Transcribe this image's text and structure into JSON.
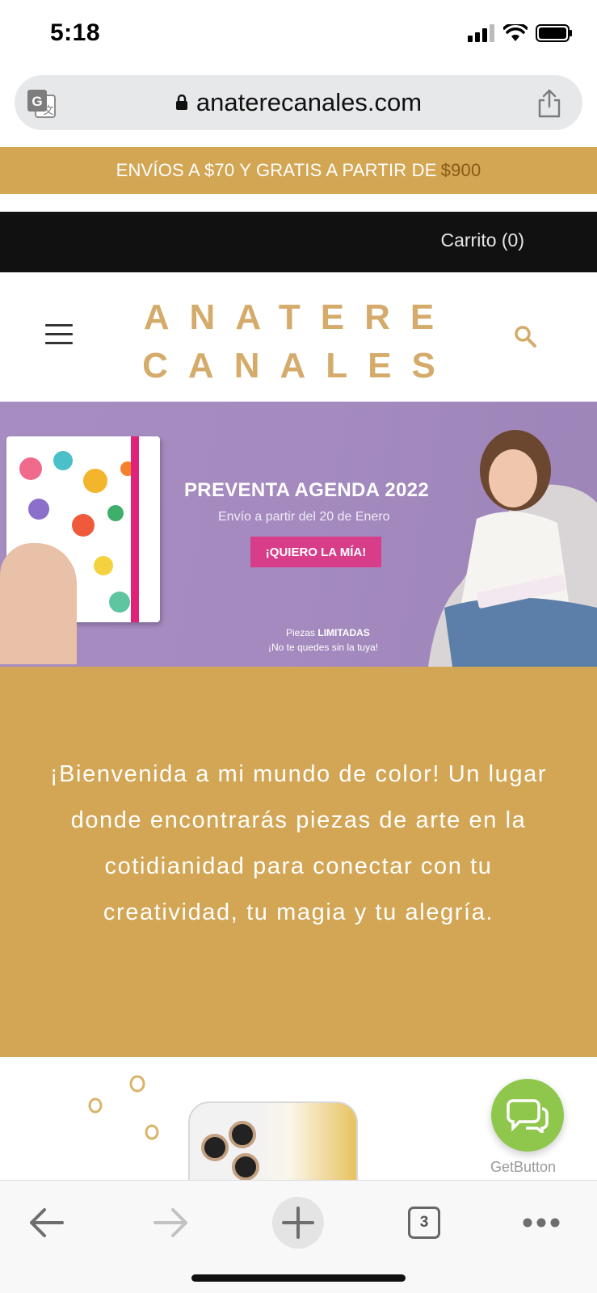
{
  "status_bar": {
    "time": "5:18"
  },
  "browser": {
    "url": "anaterecanales.com",
    "tab_count": "3"
  },
  "promo": {
    "text": "ENVÍOS A $70 Y GRATIS A PARTIR DE",
    "amount": "$900"
  },
  "cart": {
    "label": "Carrito (0)"
  },
  "header": {
    "logo_line1": "ANATERE",
    "logo_line2": "CANALES"
  },
  "hero": {
    "title": "PREVENTA AGENDA 2022",
    "subtitle": "Envío a partir del 20 de Enero",
    "cta": "¡QUIERO LA MÍA!",
    "note_prefix": "Piezas",
    "note_bold": "LIMITADAS",
    "note_line2": "¡No te quedes sin la tuya!"
  },
  "welcome": {
    "text": "¡Bienvenida a mi mundo de color! Un lugar donde encontrarás piezas de arte en la cotidianidad para conectar con tu creatividad, tu magia y tu alegría."
  },
  "getbutton": {
    "label": "GetButton"
  },
  "colors": {
    "gold": "#d3a654",
    "dark": "#111111",
    "lavender": "#a78cc1",
    "pink": "#d83d8a",
    "green": "#8fc64c"
  },
  "icons": [
    "signal-icon",
    "wifi-icon",
    "battery-icon",
    "translate-icon",
    "lock-icon",
    "share-icon",
    "menu-icon",
    "search-icon",
    "chat-icon",
    "back-icon",
    "forward-icon",
    "plus-icon",
    "tabs-icon",
    "more-icon"
  ]
}
